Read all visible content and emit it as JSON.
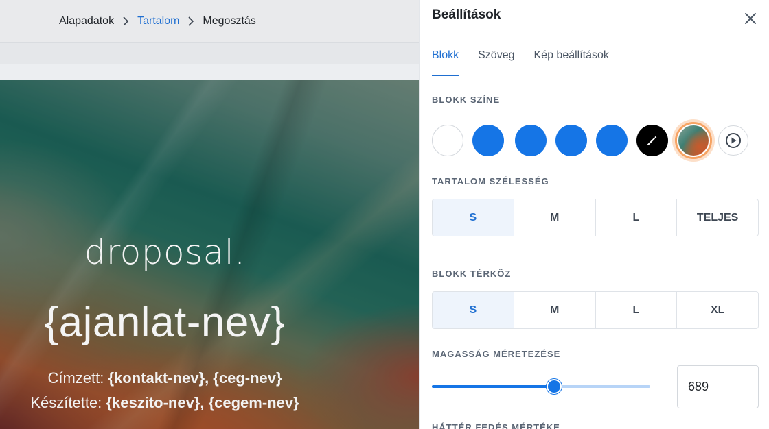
{
  "breadcrumb": {
    "items": [
      "Alapadatok",
      "Tartalom",
      "Megosztás"
    ],
    "active_index": 1
  },
  "hero": {
    "logo_text": "droposal.",
    "headline": "{ajanlat-nev}",
    "line1_label": "Címzett:",
    "line1_value": "{kontakt-nev}, {ceg-nev}",
    "line2_label": "Készítette:",
    "line2_value": "{keszito-nev}, {cegem-nev}"
  },
  "panel": {
    "title": "Beállítások",
    "tabs": [
      {
        "label": "Blokk",
        "active": true
      },
      {
        "label": "Szöveg",
        "active": false
      },
      {
        "label": "Kép beállítások",
        "active": false
      }
    ],
    "block_color": {
      "label": "BLOKK SZÍNE",
      "swatches": [
        {
          "name": "white",
          "color": "#ffffff"
        },
        {
          "name": "blue",
          "color": "#1575e6"
        },
        {
          "name": "blue",
          "color": "#1575e6"
        },
        {
          "name": "blue",
          "color": "#1575e6"
        },
        {
          "name": "blue",
          "color": "#1575e6"
        },
        {
          "name": "custom",
          "color": "#000000",
          "icon": "pencil-icon"
        },
        {
          "name": "image",
          "selected": true
        },
        {
          "name": "video",
          "icon": "play-icon"
        }
      ]
    },
    "content_width": {
      "label": "TARTALOM SZÉLESSÉG",
      "options": [
        "S",
        "M",
        "L",
        "TELJES"
      ],
      "selected": "S"
    },
    "block_spacing": {
      "label": "BLOKK TÉRKÖZ",
      "options": [
        "S",
        "M",
        "L",
        "XL"
      ],
      "selected": "S"
    },
    "height_sizing": {
      "label": "MAGASSÁG MÉRETEZÉSE",
      "slider_fraction": 0.56,
      "value": "689"
    },
    "next_section_label": "HÁTTÉR FEDÉS MÉRTÉKE"
  },
  "colors": {
    "accent": "#1f6fd1",
    "swatch_blue": "#1575e6",
    "selected_ring": "#f6a363"
  }
}
